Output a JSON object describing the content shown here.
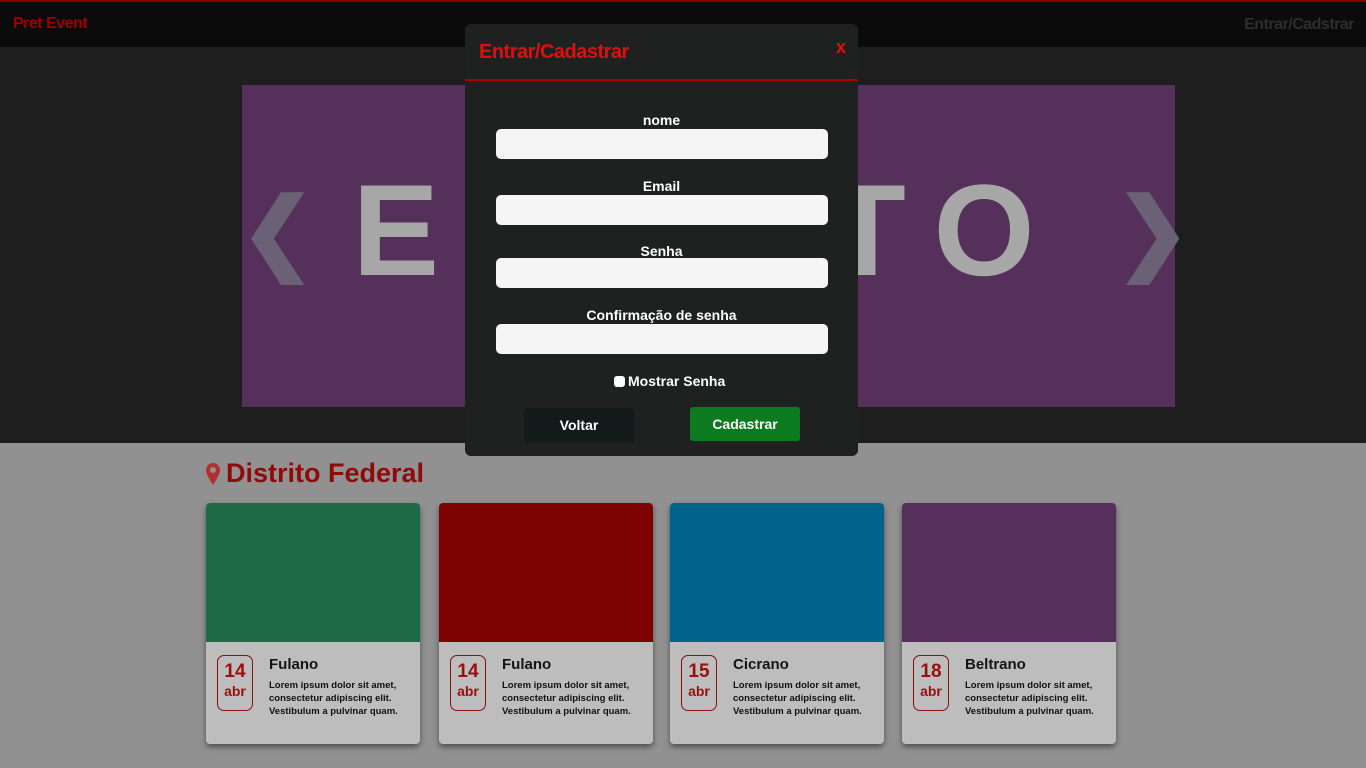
{
  "nav": {
    "brand": "Pret Event",
    "login_link": "Entrar/Cadstrar"
  },
  "hero": {
    "banner_text": "EVENTO",
    "prev_arrow": "❮",
    "next_arrow": "❯",
    "banner_color": "#54305b"
  },
  "section": {
    "icon": "map-pin-icon",
    "title": "Distrito Federal"
  },
  "cards": [
    {
      "color": "#1e6b45",
      "day": "14",
      "month": "abr",
      "title": "Fulano",
      "desc": "Lorem ipsum dolor sit amet, consectetur adipiscing elit. Vestibulum a pulvinar quam."
    },
    {
      "color": "#7d0303",
      "day": "14",
      "month": "abr",
      "title": "Fulano",
      "desc": "Lorem ipsum dolor sit amet, consectetur adipiscing elit. Vestibulum a pulvinar quam."
    },
    {
      "color": "#00638c",
      "day": "15",
      "month": "abr",
      "title": "Cicrano",
      "desc": "Lorem ipsum dolor sit amet, consectetur adipiscing elit. Vestibulum a pulvinar quam."
    },
    {
      "color": "#54305b",
      "day": "18",
      "month": "abr",
      "title": "Beltrano",
      "desc": "Lorem ipsum dolor sit amet, consectetur adipiscing elit. Vestibulum a pulvinar quam."
    }
  ],
  "modal": {
    "title": "Entrar/Cadastrar",
    "close": "x",
    "fields": [
      {
        "label": "nome",
        "value": "",
        "placeholder": ""
      },
      {
        "label": "Email",
        "value": "",
        "placeholder": ""
      },
      {
        "label": "Senha",
        "value": "",
        "placeholder": ""
      },
      {
        "label": "Confirmação de senha",
        "value": "",
        "placeholder": ""
      }
    ],
    "show_password_label": "Mostrar Senha",
    "show_password_checked": false,
    "back_button": "Voltar",
    "submit_button": "Cadastrar"
  },
  "colors": {
    "accent": "#dc1010",
    "submit": "#0b7b1f",
    "overlay_bg": "#919191"
  }
}
